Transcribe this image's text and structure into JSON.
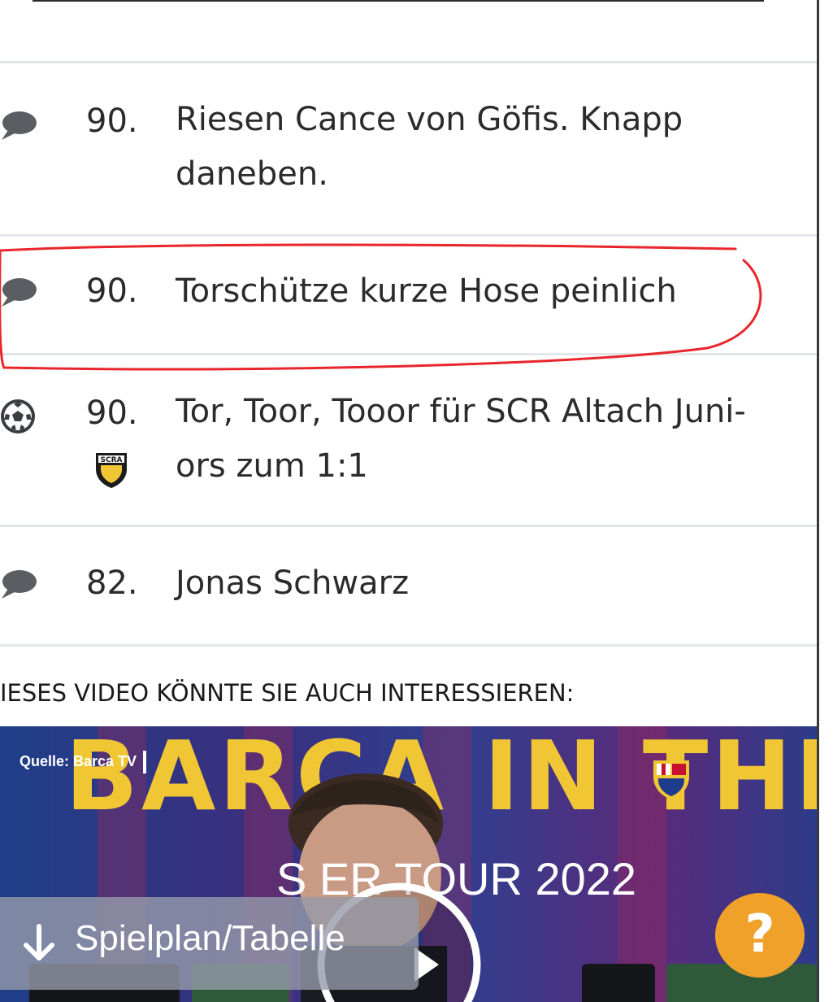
{
  "ticker": {
    "rows": [
      {
        "icon": "comment-icon",
        "minute": "90.",
        "line1": "Riesen Cance von Göfis. Knapp",
        "line2": "daneben."
      },
      {
        "icon": "comment-icon",
        "minute": "90.",
        "line1": "Torschütze kurze Hose peinlich",
        "line2": ""
      },
      {
        "icon": "soccer-ball-icon",
        "minute": "90.",
        "line1": "Tor, Toor, Tooor für SCR Altach Juni-",
        "line2": "ors zum 1:1",
        "club_badge": "SCRA"
      },
      {
        "icon": "comment-icon",
        "minute": "82.",
        "line1": "Jonas Schwarz",
        "line2": ""
      }
    ]
  },
  "video_section": {
    "title": "IESES VIDEO KÖNNTE SIE AUCH INTERESSIEREN:",
    "source_label": "Quelle: Barca TV",
    "headline": "BARCA IN THE",
    "tour_text": "S   ER TOUR 2022"
  },
  "floating": {
    "spielplan_label": "Spielplan/Tabelle",
    "help_label": "?"
  },
  "colors": {
    "highlight": "#e8262b",
    "help_button": "#f0a12a",
    "headline": "#f1c634"
  }
}
